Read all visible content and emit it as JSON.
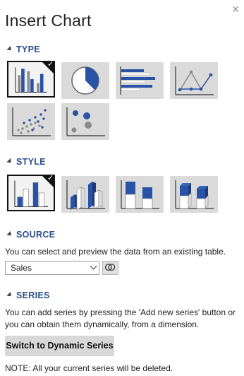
{
  "header": {
    "title": "Insert Chart",
    "close_icon": "close-icon"
  },
  "sections": {
    "type": "TYPE",
    "style": "STYLE",
    "source": "SOURCE",
    "series": "SERIES"
  },
  "chart_types": [
    {
      "name": "column",
      "selected": true
    },
    {
      "name": "pie",
      "selected": false
    },
    {
      "name": "bar",
      "selected": false
    },
    {
      "name": "line",
      "selected": false
    },
    {
      "name": "scatter",
      "selected": false
    },
    {
      "name": "bubble",
      "selected": false
    }
  ],
  "styles": [
    {
      "name": "flat",
      "selected": true
    },
    {
      "name": "3d-clustered",
      "selected": false
    },
    {
      "name": "stacked",
      "selected": false
    },
    {
      "name": "3d-stacked",
      "selected": false
    }
  ],
  "source": {
    "description": "You can select and preview the data from an existing table.",
    "selected_table": "Sales",
    "preview_icon": "link-icon"
  },
  "series": {
    "description_line1": "You can add series by pressing the 'Add new series' button or",
    "description_line2": "you can obtain them dynamically, from a dimension.",
    "button_label": "Switch to Dynamic Series",
    "note": "NOTE: All your current series will be deleted."
  },
  "colors": {
    "accent": "#2a4f8c",
    "series_blue": "#2a52a6",
    "series_gray": "#8a8a8a"
  }
}
